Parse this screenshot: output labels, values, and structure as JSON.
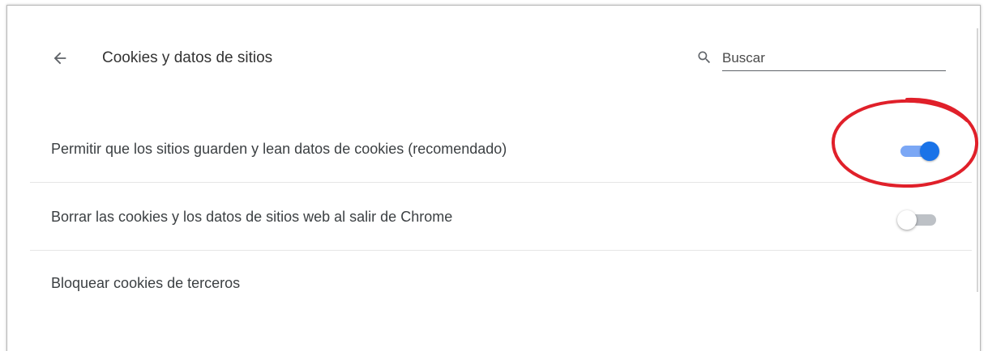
{
  "header": {
    "title": "Cookies y datos de sitios",
    "back_icon": "arrow-back-icon",
    "search": {
      "icon": "search-icon",
      "placeholder": "Buscar",
      "value": ""
    }
  },
  "settings": [
    {
      "label": "Permitir que los sitios guarden y lean datos de cookies (recomendado)",
      "toggle": "on"
    },
    {
      "label": "Borrar las cookies y los datos de sitios web al salir de Chrome",
      "toggle": "off"
    },
    {
      "label": "Bloquear cookies de terceros"
    }
  ],
  "colors": {
    "accent": "#1a73e8",
    "toggle_track_on": "#7ba7f5",
    "toggle_track_off": "#bdc1c6",
    "annotation": "#e0202a"
  }
}
